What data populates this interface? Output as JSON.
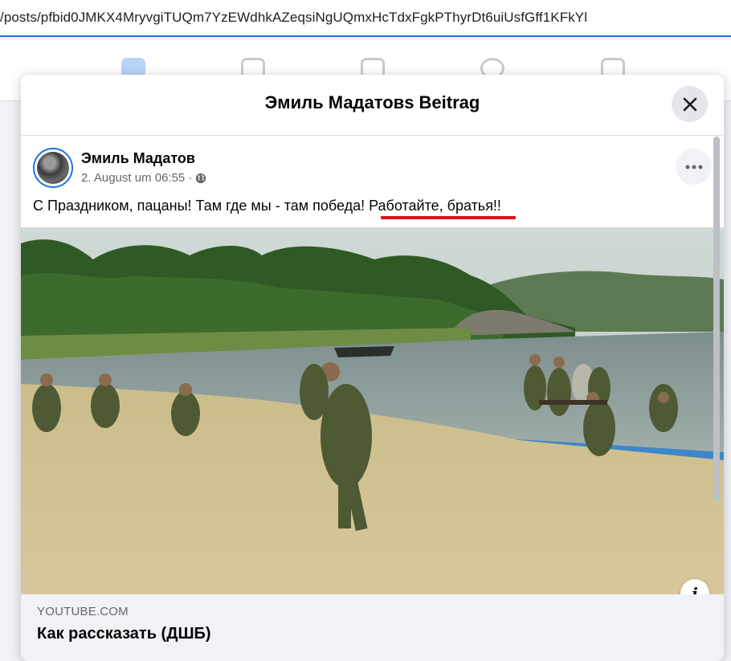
{
  "browser": {
    "url": "/posts/pfbid0JMKX4MryvgiTUQm7YzEWdhkAZeqsiNgUQmxHcTdxFgkPThyrDt6uiUsfGff1KFkYl"
  },
  "nav": {
    "icons": [
      "home-icon",
      "watch-icon",
      "marketplace-icon",
      "groups-icon",
      "gaming-icon"
    ]
  },
  "modal": {
    "title": "Эмиль Мадатовs Beitrag",
    "close_icon": "close-icon"
  },
  "post": {
    "author": "Эмиль Мадатов",
    "timestamp": "2. August um 06:55",
    "separator": "·",
    "privacy_icon": "globe-icon",
    "more_icon": "more-dots-icon",
    "text_main": "С Праздником, пацаны! Там где мы - там победа! ",
    "text_highlight": "Работайте, братья!!"
  },
  "media": {
    "info_label": "i"
  },
  "link_preview": {
    "domain": "YOUTUBE.COM",
    "title": "Как рассказать (ДШБ)"
  },
  "colors": {
    "accent": "#1b74e4",
    "url_underline": "#1a73e8",
    "highlight_underline": "#e3131d",
    "secondary_text": "#65676b",
    "panel_bg": "#f0f2f5"
  }
}
